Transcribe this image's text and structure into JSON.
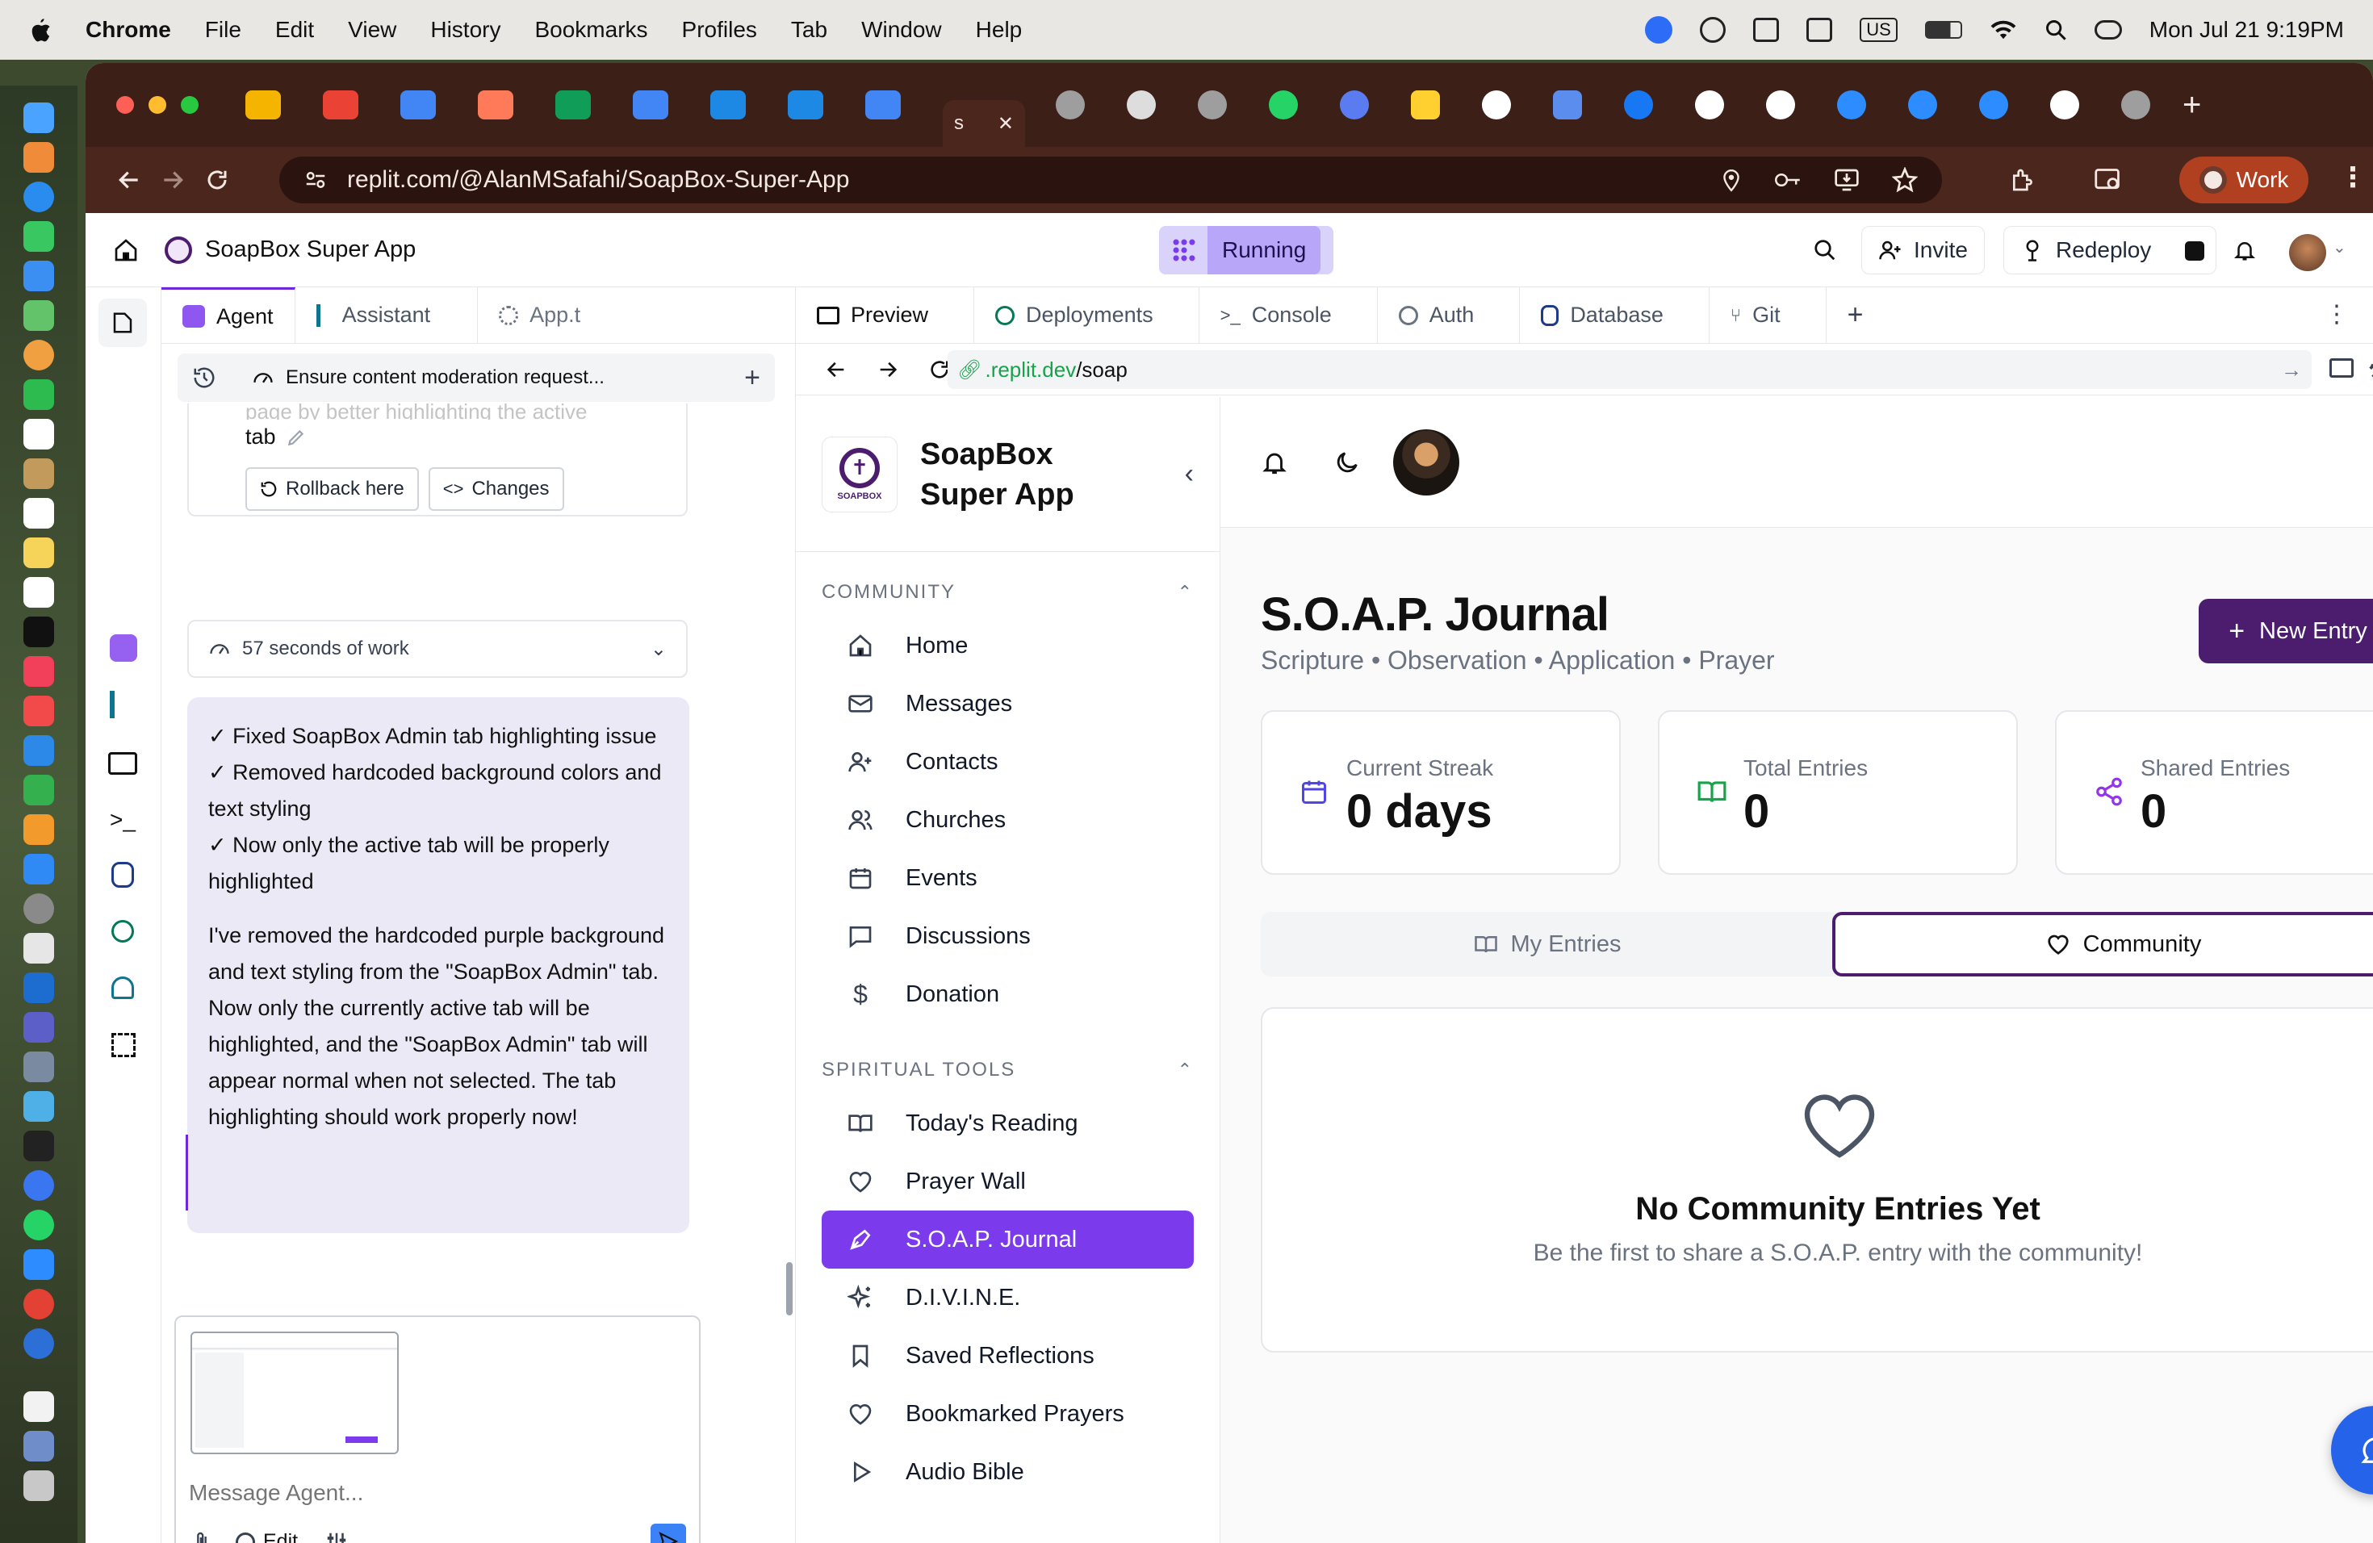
{
  "menubar": {
    "apple": "",
    "app": "Chrome",
    "items": [
      "File",
      "Edit",
      "View",
      "History",
      "Bookmarks",
      "Profiles",
      "Tab",
      "Window",
      "Help"
    ],
    "input_source": "US",
    "clock": "Mon Jul 21  9:19PM"
  },
  "browser": {
    "url": "replit.com/@AlanMSafahi/SoapBox-Super-App",
    "profile": "Work",
    "active_tab_glyph": "s"
  },
  "replit": {
    "project_name": "SoapBox Super App",
    "status": "Running",
    "invite_label": "Invite",
    "redeploy_label": "Redeploy"
  },
  "agent_panel": {
    "tabs": [
      "Agent",
      "Assistant",
      "App.t"
    ],
    "checkpoint_title": "Ensure content moderation request...",
    "partial_text": "page by better highlighting the active",
    "partial_text_2": "tab",
    "rollback_label": "Rollback here",
    "changes_label": "Changes",
    "work_time": "57 seconds of work",
    "bullets": [
      "✓ Fixed SoapBox Admin tab highlighting issue",
      "✓ Removed hardcoded background colors and text styling",
      "✓ Now only the active tab will be properly highlighted"
    ],
    "summary": "I've removed the hardcoded purple background and text styling from the \"SoapBox Admin\" tab. Now only the currently active tab will be highlighted, and the \"SoapBox Admin\" tab will appear normal when not selected. The tab highlighting should work properly now!",
    "input_placeholder": "Message Agent...",
    "edit_label": "Edit"
  },
  "preview_panel": {
    "tabs": [
      "Preview",
      "Deployments",
      "Console",
      "Auth",
      "Database",
      "Git"
    ],
    "url_domain": ".replit.dev",
    "url_path": "/soap"
  },
  "app": {
    "logo_text": "SOAPBOX",
    "brand_line1": "SoapBox",
    "brand_line2": "Super App",
    "community_header": "COMMUNITY",
    "community_items": [
      {
        "label": "Home",
        "icon": "home-icon"
      },
      {
        "label": "Messages",
        "icon": "mail-icon"
      },
      {
        "label": "Contacts",
        "icon": "user-plus-icon"
      },
      {
        "label": "Churches",
        "icon": "users-icon"
      },
      {
        "label": "Events",
        "icon": "calendar-icon"
      },
      {
        "label": "Discussions",
        "icon": "message-square-icon"
      },
      {
        "label": "Donation",
        "icon": "dollar-icon"
      }
    ],
    "tools_header": "SPIRITUAL TOOLS",
    "tools_items": [
      {
        "label": "Today's Reading",
        "icon": "book-open-icon"
      },
      {
        "label": "Prayer Wall",
        "icon": "heart-icon"
      },
      {
        "label": "S.O.A.P. Journal",
        "icon": "pen-icon",
        "active": true
      },
      {
        "label": "D.I.V.I.N.E.",
        "icon": "sparkles-icon"
      },
      {
        "label": "Saved Reflections",
        "icon": "bookmark-icon"
      },
      {
        "label": "Bookmarked Prayers",
        "icon": "heart-icon"
      },
      {
        "label": "Audio Bible",
        "icon": "play-icon"
      }
    ],
    "page_title": "S.O.A.P. Journal",
    "page_subtitle": "Scripture • Observation • Application • Prayer",
    "new_entry_label": "New Entry",
    "stats": [
      {
        "label": "Current Streak",
        "value": "0 days",
        "icon": "calendar-icon",
        "color": "#4f46e5"
      },
      {
        "label": "Total Entries",
        "value": "0",
        "icon": "book-open-icon",
        "color": "#16a34a"
      },
      {
        "label": "Shared Entries",
        "value": "0",
        "icon": "share-icon",
        "color": "#9333ea"
      }
    ],
    "tab_my_entries": "My Entries",
    "tab_community": "Community",
    "empty_title": "No Community Entries Yet",
    "empty_body": "Be the first to share a S.O.A.P. entry with the community!"
  },
  "colors": {
    "brand_purple": "#4c1d6e",
    "active_nav": "#7c3aed",
    "chrome_frame": "#4b261c",
    "fab": "#2563eb"
  }
}
